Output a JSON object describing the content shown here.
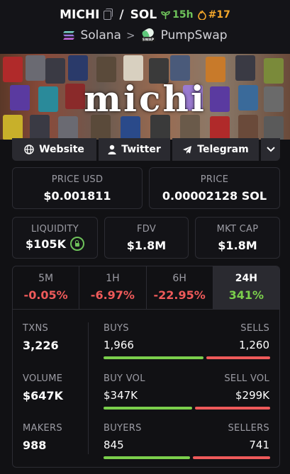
{
  "header": {
    "token": "MICHI",
    "quote": "SOL",
    "age": "15h",
    "rank": "#17",
    "chain": "Solana",
    "dex": "PumpSwap",
    "icons": {
      "copy": "copy-icon",
      "age": "sprout-icon",
      "rank": "flame-icon",
      "chain": "solana-icon",
      "dex": "pumpswap-icon"
    }
  },
  "banner": {
    "text": "michi"
  },
  "links": {
    "website": "Website",
    "twitter": "Twitter",
    "telegram": "Telegram"
  },
  "price": {
    "usd_label": "PRICE USD",
    "usd_value": "$0.001811",
    "native_label": "PRICE",
    "native_value": "0.00002128 SOL"
  },
  "metrics": {
    "liquidity_label": "LIQUIDITY",
    "liquidity_value": "$105K",
    "fdv_label": "FDV",
    "fdv_value": "$1.8M",
    "mcap_label": "MKT CAP",
    "mcap_value": "$1.8M"
  },
  "timeframes": [
    {
      "label": "5M",
      "value": "-0.05%",
      "trend": "down"
    },
    {
      "label": "1H",
      "value": "-6.97%",
      "trend": "down"
    },
    {
      "label": "6H",
      "value": "-22.95%",
      "trend": "down"
    },
    {
      "label": "24H",
      "value": "341%",
      "trend": "up",
      "active": true
    }
  ],
  "stats": {
    "txns_label": "TXNS",
    "txns_value": "3,226",
    "volume_label": "VOLUME",
    "volume_value": "$647K",
    "makers_label": "MAKERS",
    "makers_value": "988",
    "buys_label": "BUYS",
    "buys_value": "1,966",
    "sells_label": "SELLS",
    "sells_value": "1,260",
    "buy_vol_label": "BUY VOL",
    "buy_vol_value": "$347K",
    "sell_vol_label": "SELL VOL",
    "sell_vol_value": "$299K",
    "buyers_label": "BUYERS",
    "buyers_value": "845",
    "sellers_label": "SELLERS",
    "sellers_value": "741",
    "buys_share": 0.61,
    "buy_vol_share": 0.54,
    "buyers_share": 0.53
  },
  "colors": {
    "positive": "#7bcf4c",
    "negative": "#ef5a5a",
    "rank": "#f4a72a",
    "background": "#111114"
  }
}
